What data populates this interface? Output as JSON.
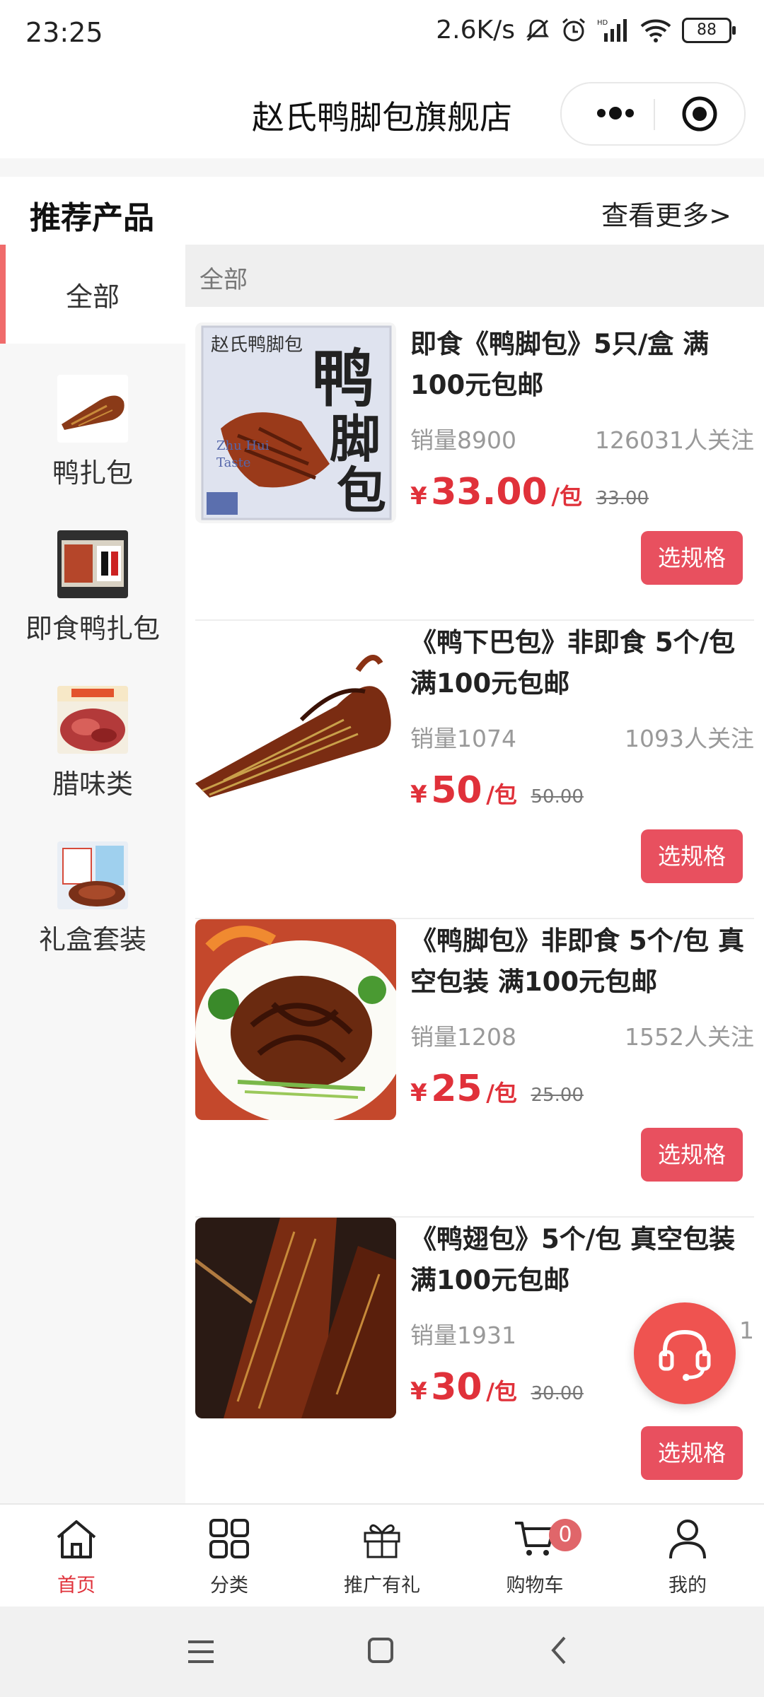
{
  "status_bar": {
    "time": "23:25",
    "speed": "2.6K/s",
    "battery": "88",
    "icons": [
      "mute-icon",
      "alarm-icon",
      "hd-signal-icon",
      "wifi-icon",
      "battery-icon"
    ]
  },
  "navbar": {
    "title": "赵氏鸭脚包旗舰店",
    "menu_icon": "more-dots-icon",
    "close_icon": "target-icon"
  },
  "section": {
    "title": "推荐产品",
    "more": "查看更多>"
  },
  "sidebar": {
    "items": [
      {
        "label": "全部",
        "active": true
      },
      {
        "label": "鸭扎包",
        "thumb": "duck-wrap-thumb"
      },
      {
        "label": "即食鸭扎包",
        "thumb": "ready-duck-wrap-thumb"
      },
      {
        "label": "腊味类",
        "thumb": "cured-meat-thumb"
      },
      {
        "label": "礼盒套装",
        "thumb": "gift-box-thumb"
      }
    ]
  },
  "content": {
    "category_label": "全部",
    "products": [
      {
        "name": "即食《鸭脚包》5只/盒 满100元包邮",
        "sales": "销量8900",
        "follow": "126031人关注",
        "yen": "¥",
        "price": "33.00",
        "unit": "/包",
        "orig": "33.00",
        "button": "选规格"
      },
      {
        "name": "《鸭下巴包》非即食 5个/包 满100元包邮",
        "sales": "销量1074",
        "follow": "1093人关注",
        "yen": "¥",
        "price": "50",
        "unit": "/包",
        "orig": "50.00",
        "button": "选规格"
      },
      {
        "name": "《鸭脚包》非即食 5个/包 真空包装 满100元包邮",
        "sales": "销量1208",
        "follow": "1552人关注",
        "yen": "¥",
        "price": "25",
        "unit": "/包",
        "orig": "25.00",
        "button": "选规格"
      },
      {
        "name": "《鸭翅包》5个/包 真空包装 满100元包邮",
        "sales": "销量1931",
        "follow": "1",
        "yen": "¥",
        "price": "30",
        "unit": "/包",
        "orig": "30.00",
        "button": "选规格"
      }
    ]
  },
  "tabbar": {
    "items": [
      {
        "label": "首页",
        "icon": "home-icon",
        "active": true
      },
      {
        "label": "分类",
        "icon": "grid-icon"
      },
      {
        "label": "推广有礼",
        "icon": "gift-icon"
      },
      {
        "label": "购物车",
        "icon": "cart-icon",
        "badge": "0"
      },
      {
        "label": "我的",
        "icon": "user-icon"
      }
    ]
  },
  "colors": {
    "accent": "#e0313a",
    "button": "#e8505f",
    "fab": "#ef5350"
  }
}
